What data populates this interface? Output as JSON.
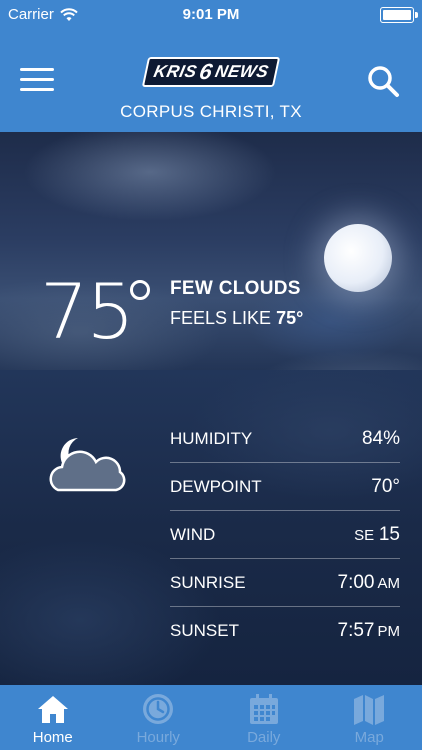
{
  "status_bar": {
    "carrier": "Carrier",
    "time": "9:01 PM"
  },
  "header": {
    "logo_left": "KRIS",
    "logo_num": "6",
    "logo_right": "NEWS",
    "location": "CORPUS CHRISTI, TX",
    "menu_icon": "hamburger-menu-icon",
    "search_icon": "search-icon"
  },
  "current": {
    "temperature": "75",
    "condition": "FEW CLOUDS",
    "feels_like_label": "FEELS LIKE",
    "feels_like_value": "75°",
    "icon": "moon-cloud-icon"
  },
  "details": [
    {
      "label": "HUMIDITY",
      "value": "84%",
      "unit": ""
    },
    {
      "label": "DEWPOINT",
      "value": "70°",
      "unit": ""
    },
    {
      "label": "WIND",
      "value": "15",
      "unit": "",
      "prefix": "SE"
    },
    {
      "label": "SUNRISE",
      "value": "7:00",
      "unit": "AM"
    },
    {
      "label": "SUNSET",
      "value": "7:57",
      "unit": "PM"
    }
  ],
  "tabs": [
    {
      "label": "Home",
      "icon": "home-icon",
      "active": true
    },
    {
      "label": "Hourly",
      "icon": "clock-icon",
      "active": false
    },
    {
      "label": "Daily",
      "icon": "calendar-icon",
      "active": false
    },
    {
      "label": "Map",
      "icon": "map-icon",
      "active": false
    }
  ],
  "colors": {
    "brand_blue": "#3f86cf",
    "inactive_tab": "#79a9dc"
  }
}
